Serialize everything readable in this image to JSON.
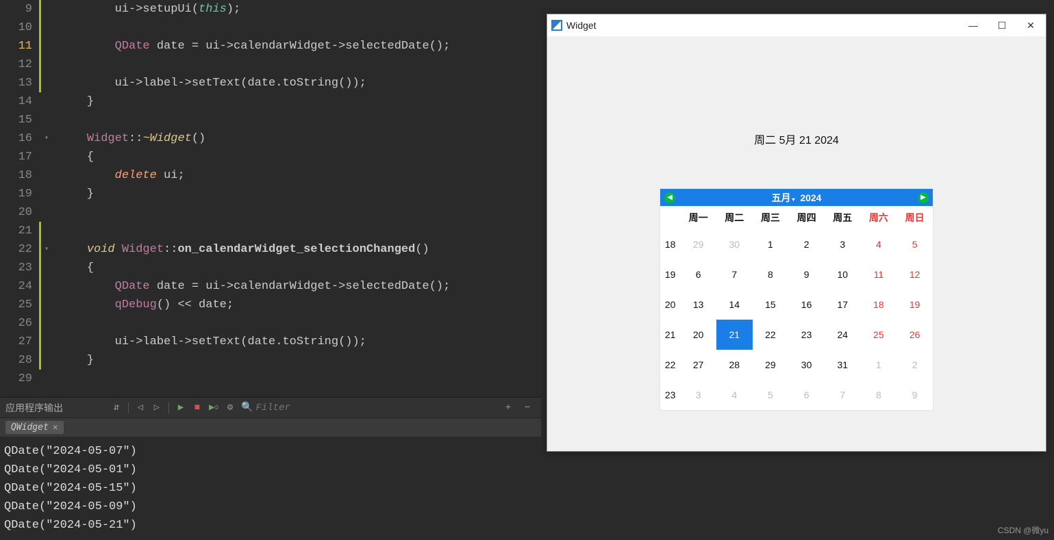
{
  "editor": {
    "lines": [
      {
        "num": "9",
        "changed": true,
        "fold": "",
        "html": "        ui->setupUi(<span class='this'>this</span>);"
      },
      {
        "num": "10",
        "changed": true,
        "fold": "",
        "html": ""
      },
      {
        "num": "11",
        "changed": true,
        "fold": "",
        "current": true,
        "html": "        <span class='type'>QDate</span> date = ui->calendarWidget->selectedDate();"
      },
      {
        "num": "12",
        "changed": true,
        "fold": "",
        "html": ""
      },
      {
        "num": "13",
        "changed": true,
        "fold": "",
        "html": "        ui->label->setText(date.toString());"
      },
      {
        "num": "14",
        "changed": false,
        "fold": "",
        "html": "    }"
      },
      {
        "num": "15",
        "changed": false,
        "fold": "",
        "html": ""
      },
      {
        "num": "16",
        "changed": false,
        "fold": "▾",
        "html": "    <span class='type'>Widget</span>::<span class='kw'>~Widget</span>()"
      },
      {
        "num": "17",
        "changed": false,
        "fold": "",
        "html": "    {"
      },
      {
        "num": "18",
        "changed": false,
        "fold": "",
        "html": "        <span class='keyword2'>delete</span> ui;"
      },
      {
        "num": "19",
        "changed": false,
        "fold": "",
        "html": "    }"
      },
      {
        "num": "20",
        "changed": false,
        "fold": "",
        "html": ""
      },
      {
        "num": "21",
        "changed": true,
        "fold": "",
        "html": ""
      },
      {
        "num": "22",
        "changed": true,
        "fold": "▾",
        "html": "    <span class='kw'>void</span> <span class='type'>Widget</span>::<span class='bold'>on_calendarWidget_selectionChanged</span>()"
      },
      {
        "num": "23",
        "changed": true,
        "fold": "",
        "html": "    {"
      },
      {
        "num": "24",
        "changed": true,
        "fold": "",
        "html": "        <span class='type'>QDate</span> date = ui->calendarWidget->selectedDate();"
      },
      {
        "num": "25",
        "changed": true,
        "fold": "",
        "html": "        <span class='type'>qDebug</span>() << date;"
      },
      {
        "num": "26",
        "changed": true,
        "fold": "",
        "html": ""
      },
      {
        "num": "27",
        "changed": true,
        "fold": "",
        "html": "        ui->label->setText(date.toString());"
      },
      {
        "num": "28",
        "changed": true,
        "fold": "",
        "html": "    }"
      },
      {
        "num": "29",
        "changed": false,
        "fold": "",
        "html": ""
      }
    ]
  },
  "output": {
    "title": "应用程序输出",
    "filter_placeholder": "Filter",
    "tab": "QWidget",
    "lines": [
      "QDate(\"2024-05-07\")",
      "QDate(\"2024-05-01\")",
      "QDate(\"2024-05-15\")",
      "QDate(\"2024-05-09\")",
      "QDate(\"2024-05-21\")"
    ]
  },
  "dialog": {
    "title": "Widget",
    "date_label": "周二 5月 21 2024",
    "calendar": {
      "month": "五月",
      "year": "2024",
      "weekdays": [
        "周一",
        "周二",
        "周三",
        "周四",
        "周五",
        "周六",
        "周日"
      ],
      "rows": [
        {
          "wn": "18",
          "days": [
            {
              "d": "29",
              "o": true
            },
            {
              "d": "30",
              "o": true
            },
            {
              "d": "1"
            },
            {
              "d": "2"
            },
            {
              "d": "3"
            },
            {
              "d": "4",
              "we": true
            },
            {
              "d": "5",
              "we": true
            }
          ]
        },
        {
          "wn": "19",
          "days": [
            {
              "d": "6"
            },
            {
              "d": "7"
            },
            {
              "d": "8"
            },
            {
              "d": "9"
            },
            {
              "d": "10"
            },
            {
              "d": "11",
              "we": true
            },
            {
              "d": "12",
              "we": true
            }
          ]
        },
        {
          "wn": "20",
          "days": [
            {
              "d": "13"
            },
            {
              "d": "14"
            },
            {
              "d": "15"
            },
            {
              "d": "16"
            },
            {
              "d": "17"
            },
            {
              "d": "18",
              "we": true
            },
            {
              "d": "19",
              "we": true
            }
          ]
        },
        {
          "wn": "21",
          "days": [
            {
              "d": "20"
            },
            {
              "d": "21",
              "sel": true
            },
            {
              "d": "22"
            },
            {
              "d": "23"
            },
            {
              "d": "24"
            },
            {
              "d": "25",
              "we": true
            },
            {
              "d": "26",
              "we": true
            }
          ]
        },
        {
          "wn": "22",
          "days": [
            {
              "d": "27"
            },
            {
              "d": "28"
            },
            {
              "d": "29"
            },
            {
              "d": "30"
            },
            {
              "d": "31"
            },
            {
              "d": "1",
              "o": true
            },
            {
              "d": "2",
              "o": true
            }
          ]
        },
        {
          "wn": "23",
          "days": [
            {
              "d": "3",
              "o": true
            },
            {
              "d": "4",
              "o": true
            },
            {
              "d": "5",
              "o": true
            },
            {
              "d": "6",
              "o": true
            },
            {
              "d": "7",
              "o": true
            },
            {
              "d": "8",
              "o": true
            },
            {
              "d": "9",
              "o": true
            }
          ]
        }
      ]
    }
  },
  "watermark": "CSDN @微yu"
}
